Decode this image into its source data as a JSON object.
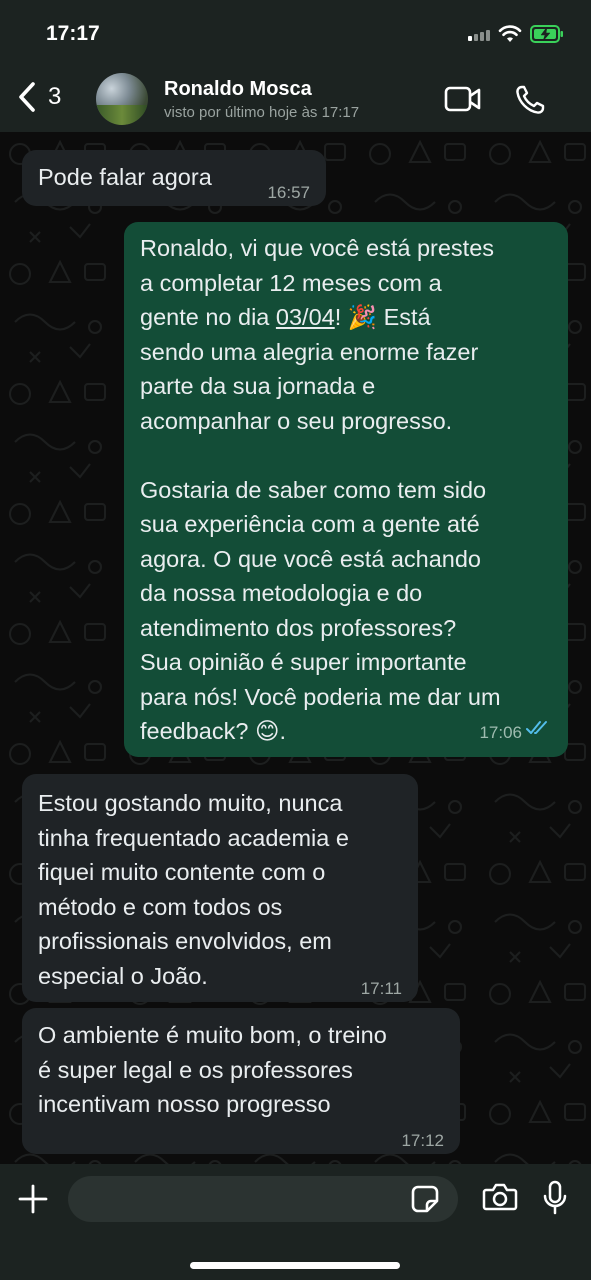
{
  "status_bar": {
    "time": "17:17",
    "icons": [
      "signal-icon",
      "wifi-icon",
      "battery-charging-icon"
    ],
    "battery_color": "#3ad15a"
  },
  "header": {
    "unread_count": "3",
    "contact_name": "Ronaldo Mosca",
    "last_seen": "visto por último hoje às 17:17",
    "icons": [
      "back-chevron-icon",
      "video-call-icon",
      "phone-icon"
    ]
  },
  "messages": [
    {
      "direction": "incoming",
      "text": "Pode falar agora",
      "time": "16:57"
    },
    {
      "direction": "outgoing",
      "text_part1": "Ronaldo, vi que você está prestes\na completar 12 meses com a\ngente no dia ",
      "date_link": "03/04",
      "text_part2": "! 🎉 Está\nsendo uma alegria enorme fazer\nparte da sua jornada e\nacompanhar o seu progresso.\n\nGostaria de saber como tem sido\nsua experiência com a gente até\nagora. O que você está achando\nda nossa metodologia e do\natendimento dos professores?\nSua opinião é super importante\npara nós! Você poderia me dar um\nfeedback? 😊.",
      "time": "17:06",
      "status": "read"
    },
    {
      "direction": "incoming",
      "text": "Estou gostando muito, nunca\ntinha frequentado academia e\nfiquei muito contente com o\nmétodo e com todos os\nprofissionais envolvidos, em\nespecial o João.",
      "time": "17:11"
    },
    {
      "direction": "incoming",
      "text": "O ambiente é muito bom, o treino\né super legal e os professores\nincentivam nosso progresso",
      "time": "17:12"
    }
  ],
  "colors": {
    "incoming_bubble": "#1f2326",
    "outgoing_bubble": "#134d37",
    "read_ticks": "#53bdeb"
  },
  "composer": {
    "input_value": "",
    "icons": [
      "plus-icon",
      "sticker-icon",
      "camera-icon",
      "microphone-icon"
    ]
  }
}
